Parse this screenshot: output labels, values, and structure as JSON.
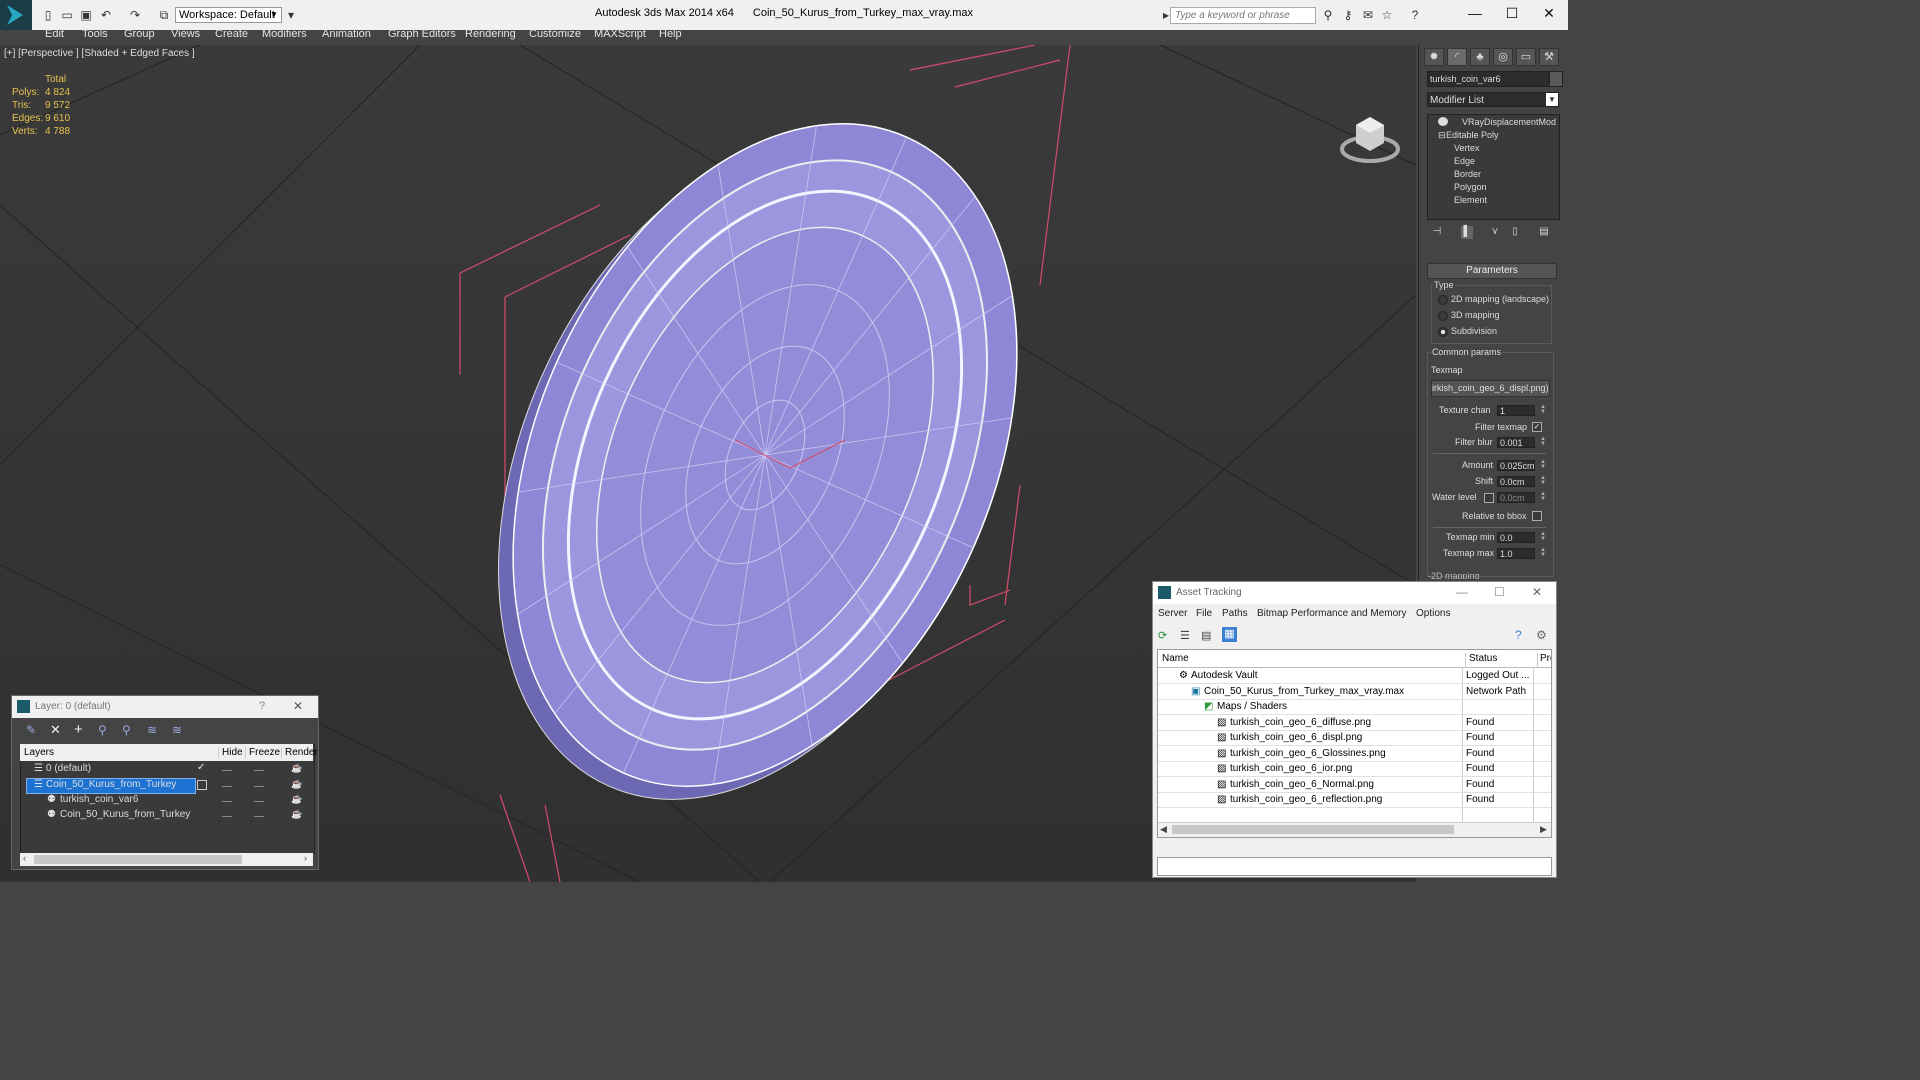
{
  "titlebar": {
    "app": "Autodesk 3ds Max  2014 x64",
    "file": "Coin_50_Kurus_from_Turkey_max_vray.max",
    "workspace": "Workspace: Default",
    "search_placeholder": "Type a keyword or phrase"
  },
  "menu": [
    "Edit",
    "Tools",
    "Group",
    "Views",
    "Create",
    "Modifiers",
    "Animation",
    "Graph Editors",
    "Rendering",
    "Customize",
    "MAXScript",
    "Help"
  ],
  "viewport": {
    "label": "[+] [Perspective ] [Shaded + Edged Faces ]",
    "stats": {
      "total_label": "Total",
      "rows": [
        {
          "label": "Polys:",
          "value": "4 824"
        },
        {
          "label": "Tris:",
          "value": "9 572"
        },
        {
          "label": "Edges:",
          "value": "9 610"
        },
        {
          "label": "Verts:",
          "value": "4 788"
        }
      ]
    }
  },
  "command_panel": {
    "object_name": "turkish_coin_var6",
    "modifier_list": "Modifier List",
    "stack": [
      "VRayDisplacementMod",
      "Editable Poly",
      "Vertex",
      "Edge",
      "Border",
      "Polygon",
      "Element"
    ],
    "parameters_title": "Parameters",
    "type_label": "Type",
    "type_options": [
      "2D mapping (landscape)",
      "3D mapping",
      "Subdivision"
    ],
    "type_selected": 2,
    "common_params": "Common params",
    "texmap_label": "Texmap",
    "texmap_value": "irkish_coin_geo_6_displ.png)",
    "texture_chan_label": "Texture chan",
    "texture_chan_value": "1",
    "filter_texmap_label": "Filter texmap",
    "filter_blur_label": "Filter blur",
    "filter_blur_value": "0.001",
    "amount_label": "Amount",
    "amount_value": "0.025cm",
    "shift_label": "Shift",
    "shift_value": "0.0cm",
    "water_level_label": "Water level",
    "water_level_value": "0.0cm",
    "relative_bbox_label": "Relative to bbox",
    "texmap_min_label": "Texmap min",
    "texmap_min_value": "0.0",
    "texmap_max_label": "Texmap max",
    "texmap_max_value": "1.0",
    "mapping_rollout": "2D mapping"
  },
  "asset_tracking": {
    "title": "Asset Tracking",
    "menu": [
      "Server",
      "File",
      "Paths",
      "Bitmap Performance and Memory",
      "Options"
    ],
    "columns": [
      "Name",
      "Status",
      "Pro"
    ],
    "rows": [
      {
        "name": "Autodesk Vault",
        "status": "Logged Out ..."
      },
      {
        "name": "Coin_50_Kurus_from_Turkey_max_vray.max",
        "status": "Network Path"
      },
      {
        "name": "Maps / Shaders",
        "status": ""
      },
      {
        "name": "turkish_coin_geo_6_diffuse.png",
        "status": "Found"
      },
      {
        "name": "turkish_coin_geo_6_displ.png",
        "status": "Found"
      },
      {
        "name": "turkish_coin_geo_6_Glossines.png",
        "status": "Found"
      },
      {
        "name": "turkish_coin_geo_6_ior.png",
        "status": "Found"
      },
      {
        "name": "turkish_coin_geo_6_Normal.png",
        "status": "Found"
      },
      {
        "name": "turkish_coin_geo_6_reflection.png",
        "status": "Found"
      }
    ]
  },
  "layer_panel": {
    "title": "Layer: 0 (default)",
    "help": "?",
    "columns": [
      "Layers",
      "Hide",
      "Freeze",
      "Render"
    ],
    "rows": [
      {
        "name": "0 (default)"
      },
      {
        "name": "Coin_50_Kurus_from_Turkey"
      },
      {
        "name": "turkish_coin_var6"
      },
      {
        "name": "Coin_50_Kurus_from_Turkey"
      }
    ]
  },
  "colors": {
    "accent_select": "#1e73d2",
    "coin_fill": "#8d87d6",
    "stats_text": "#e8c250",
    "bbox_line": "#d24c6a"
  }
}
